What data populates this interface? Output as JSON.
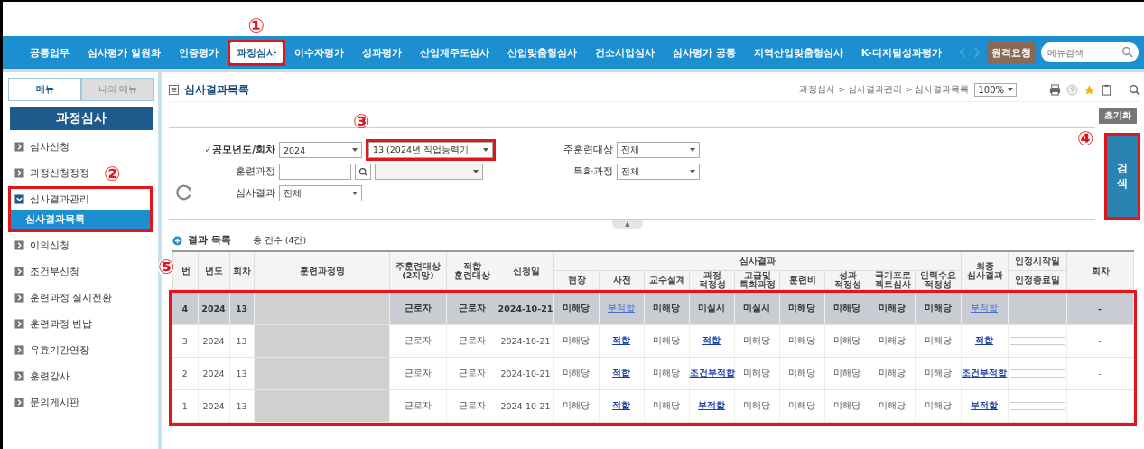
{
  "nav": {
    "items": [
      {
        "label": "공통업무",
        "selected": false
      },
      {
        "label": "심사평가 일원화",
        "selected": false
      },
      {
        "label": "인증평가",
        "selected": false
      },
      {
        "label": "과정심사",
        "selected": true,
        "marked": true,
        "badge": "①"
      },
      {
        "label": "이수자평가",
        "selected": false
      },
      {
        "label": "성과평가",
        "selected": false
      },
      {
        "label": "산업계주도심사",
        "selected": false
      },
      {
        "label": "산업맞춤형심사",
        "selected": false
      },
      {
        "label": "건소시업심사",
        "selected": false
      },
      {
        "label": "심사평가 공통",
        "selected": false
      },
      {
        "label": "지역산업맞춤형심사",
        "selected": false
      },
      {
        "label": "K-디지털성과평가",
        "selected": false
      }
    ],
    "remote_button": "원격요청",
    "search": {
      "placeholder": "메뉴검색"
    }
  },
  "sidebar": {
    "tabs": [
      {
        "label": "메뉴",
        "selected": true
      },
      {
        "label": "나의 메뉴",
        "selected": false
      }
    ],
    "heading": "과정심사",
    "items": [
      {
        "label": "심사신청",
        "expanded": false
      },
      {
        "label": "과정신청정정",
        "expanded": false
      },
      {
        "label": "심사결과관리",
        "expanded": true,
        "marked": true,
        "badge": "②",
        "children": [
          {
            "label": "심사결과목록",
            "selected": true
          }
        ]
      },
      {
        "label": "이의신청",
        "expanded": false
      },
      {
        "label": "조건부신청",
        "expanded": false
      },
      {
        "label": "훈련과정 실시전환",
        "expanded": false
      },
      {
        "label": "훈련과정 반납",
        "expanded": false
      },
      {
        "label": "유효기간연장",
        "expanded": false
      },
      {
        "label": "훈련강사",
        "expanded": false
      },
      {
        "label": "문의게시판",
        "expanded": false
      }
    ]
  },
  "page": {
    "title": "심사결과목록",
    "breadcrumb": "과정심사 > 심사결과관리 > 심사결과목록",
    "zoom": "100%"
  },
  "filters": {
    "reset_button": "초기화",
    "search_button": {
      "label": "검색",
      "marked": true,
      "badge": "④"
    },
    "collapse_toggle": "▲",
    "left": [
      {
        "kind": "pair",
        "prefix": "✓",
        "label": "공모년도/회차",
        "value": "2024",
        "value2": "13 (2024년 직업능력기",
        "marked2": true,
        "badge2": "③"
      },
      {
        "kind": "lookup",
        "label": "훈련과정"
      },
      {
        "kind": "select",
        "label": "심사결과",
        "value": "전체"
      }
    ],
    "right": [
      {
        "kind": "select",
        "label": "주훈련대상",
        "value": "전체"
      },
      {
        "kind": "select",
        "label": "특화과정",
        "value": "전체"
      }
    ]
  },
  "list": {
    "title": "결과 목록",
    "count": "총 건수 (4건)",
    "marked": true,
    "badge": "⑤",
    "columns": [
      {
        "label": "번"
      },
      {
        "label": "년도"
      },
      {
        "label": "회차"
      },
      {
        "label": "훈련과정명"
      },
      {
        "label": "주훈련대상\n(2지망)"
      },
      {
        "label": "적합\n훈련대상"
      },
      {
        "label": "신청일"
      },
      {
        "label": "심사결과",
        "colspan": 9,
        "children": [
          "현장",
          "사전",
          "교수설계",
          "과정\n적정성",
          "고급및\n특화과정",
          "훈련비",
          "성과\n적정성",
          "국기프로\n젝트심사",
          "인력수요\n적정성"
        ]
      },
      {
        "label": "최종\n심사결과"
      },
      {
        "label": "인정시작일",
        "label2": "인정종료일"
      },
      {
        "label": "회차"
      }
    ],
    "rows": [
      {
        "selected": true,
        "cells": [
          {
            "kind": "text",
            "text": "4"
          },
          {
            "kind": "text",
            "text": "2024"
          },
          {
            "kind": "text",
            "text": "13"
          },
          {
            "kind": "redacted"
          },
          {
            "kind": "text",
            "text": "근로자"
          },
          {
            "kind": "text",
            "text": "근로자"
          },
          {
            "kind": "text",
            "text": "2024-10-21"
          },
          {
            "kind": "text",
            "text": "미해당"
          },
          {
            "kind": "link",
            "text": "부적합"
          },
          {
            "kind": "text",
            "text": "미해당"
          },
          {
            "kind": "text",
            "text": "미실시"
          },
          {
            "kind": "text",
            "text": "미실시"
          },
          {
            "kind": "text",
            "text": "미해당"
          },
          {
            "kind": "text",
            "text": "미해당"
          },
          {
            "kind": "text",
            "text": "미해당"
          },
          {
            "kind": "text",
            "text": "미해당"
          },
          {
            "kind": "link",
            "text": "부적합"
          },
          {
            "kind": "dates"
          },
          {
            "kind": "text",
            "text": "-"
          }
        ]
      },
      {
        "selected": false,
        "cells": [
          {
            "kind": "text",
            "text": "3"
          },
          {
            "kind": "text",
            "text": "2024"
          },
          {
            "kind": "text",
            "text": "13"
          },
          {
            "kind": "redacted"
          },
          {
            "kind": "text",
            "text": "근로자"
          },
          {
            "kind": "text",
            "text": "근로자"
          },
          {
            "kind": "text",
            "text": "2024-10-21"
          },
          {
            "kind": "text",
            "text": "미해당"
          },
          {
            "kind": "link",
            "text": "적합"
          },
          {
            "kind": "text",
            "text": "미해당"
          },
          {
            "kind": "link",
            "text": "적합"
          },
          {
            "kind": "text",
            "text": "미해당"
          },
          {
            "kind": "text",
            "text": "미해당"
          },
          {
            "kind": "text",
            "text": "미해당"
          },
          {
            "kind": "text",
            "text": "미해당"
          },
          {
            "kind": "text",
            "text": "미해당"
          },
          {
            "kind": "link",
            "text": "적합"
          },
          {
            "kind": "dates"
          },
          {
            "kind": "text",
            "text": "-"
          }
        ]
      },
      {
        "selected": false,
        "cells": [
          {
            "kind": "text",
            "text": "2"
          },
          {
            "kind": "text",
            "text": "2024"
          },
          {
            "kind": "text",
            "text": "13"
          },
          {
            "kind": "redacted"
          },
          {
            "kind": "text",
            "text": "근로자"
          },
          {
            "kind": "text",
            "text": "근로자"
          },
          {
            "kind": "text",
            "text": "2024-10-21"
          },
          {
            "kind": "text",
            "text": "미해당"
          },
          {
            "kind": "link",
            "text": "적합"
          },
          {
            "kind": "text",
            "text": "미해당"
          },
          {
            "kind": "link",
            "text": "조건부적합"
          },
          {
            "kind": "text",
            "text": "미해당"
          },
          {
            "kind": "text",
            "text": "미해당"
          },
          {
            "kind": "text",
            "text": "미해당"
          },
          {
            "kind": "text",
            "text": "미해당"
          },
          {
            "kind": "text",
            "text": "미해당"
          },
          {
            "kind": "link",
            "text": "조건부적합"
          },
          {
            "kind": "dates"
          },
          {
            "kind": "text",
            "text": "-"
          }
        ]
      },
      {
        "selected": false,
        "cells": [
          {
            "kind": "text",
            "text": "1"
          },
          {
            "kind": "text",
            "text": "2024"
          },
          {
            "kind": "text",
            "text": "13"
          },
          {
            "kind": "redacted"
          },
          {
            "kind": "text",
            "text": "근로자"
          },
          {
            "kind": "text",
            "text": "근로자"
          },
          {
            "kind": "text",
            "text": "2024-10-21"
          },
          {
            "kind": "text",
            "text": "미해당"
          },
          {
            "kind": "link",
            "text": "적합"
          },
          {
            "kind": "text",
            "text": "미해당"
          },
          {
            "kind": "link",
            "text": "부적합"
          },
          {
            "kind": "text",
            "text": "미해당"
          },
          {
            "kind": "text",
            "text": "미해당"
          },
          {
            "kind": "text",
            "text": "미해당"
          },
          {
            "kind": "text",
            "text": "미해당"
          },
          {
            "kind": "text",
            "text": "미해당"
          },
          {
            "kind": "link",
            "text": "부적합"
          },
          {
            "kind": "dates"
          },
          {
            "kind": "text",
            "text": "-"
          }
        ]
      }
    ]
  }
}
